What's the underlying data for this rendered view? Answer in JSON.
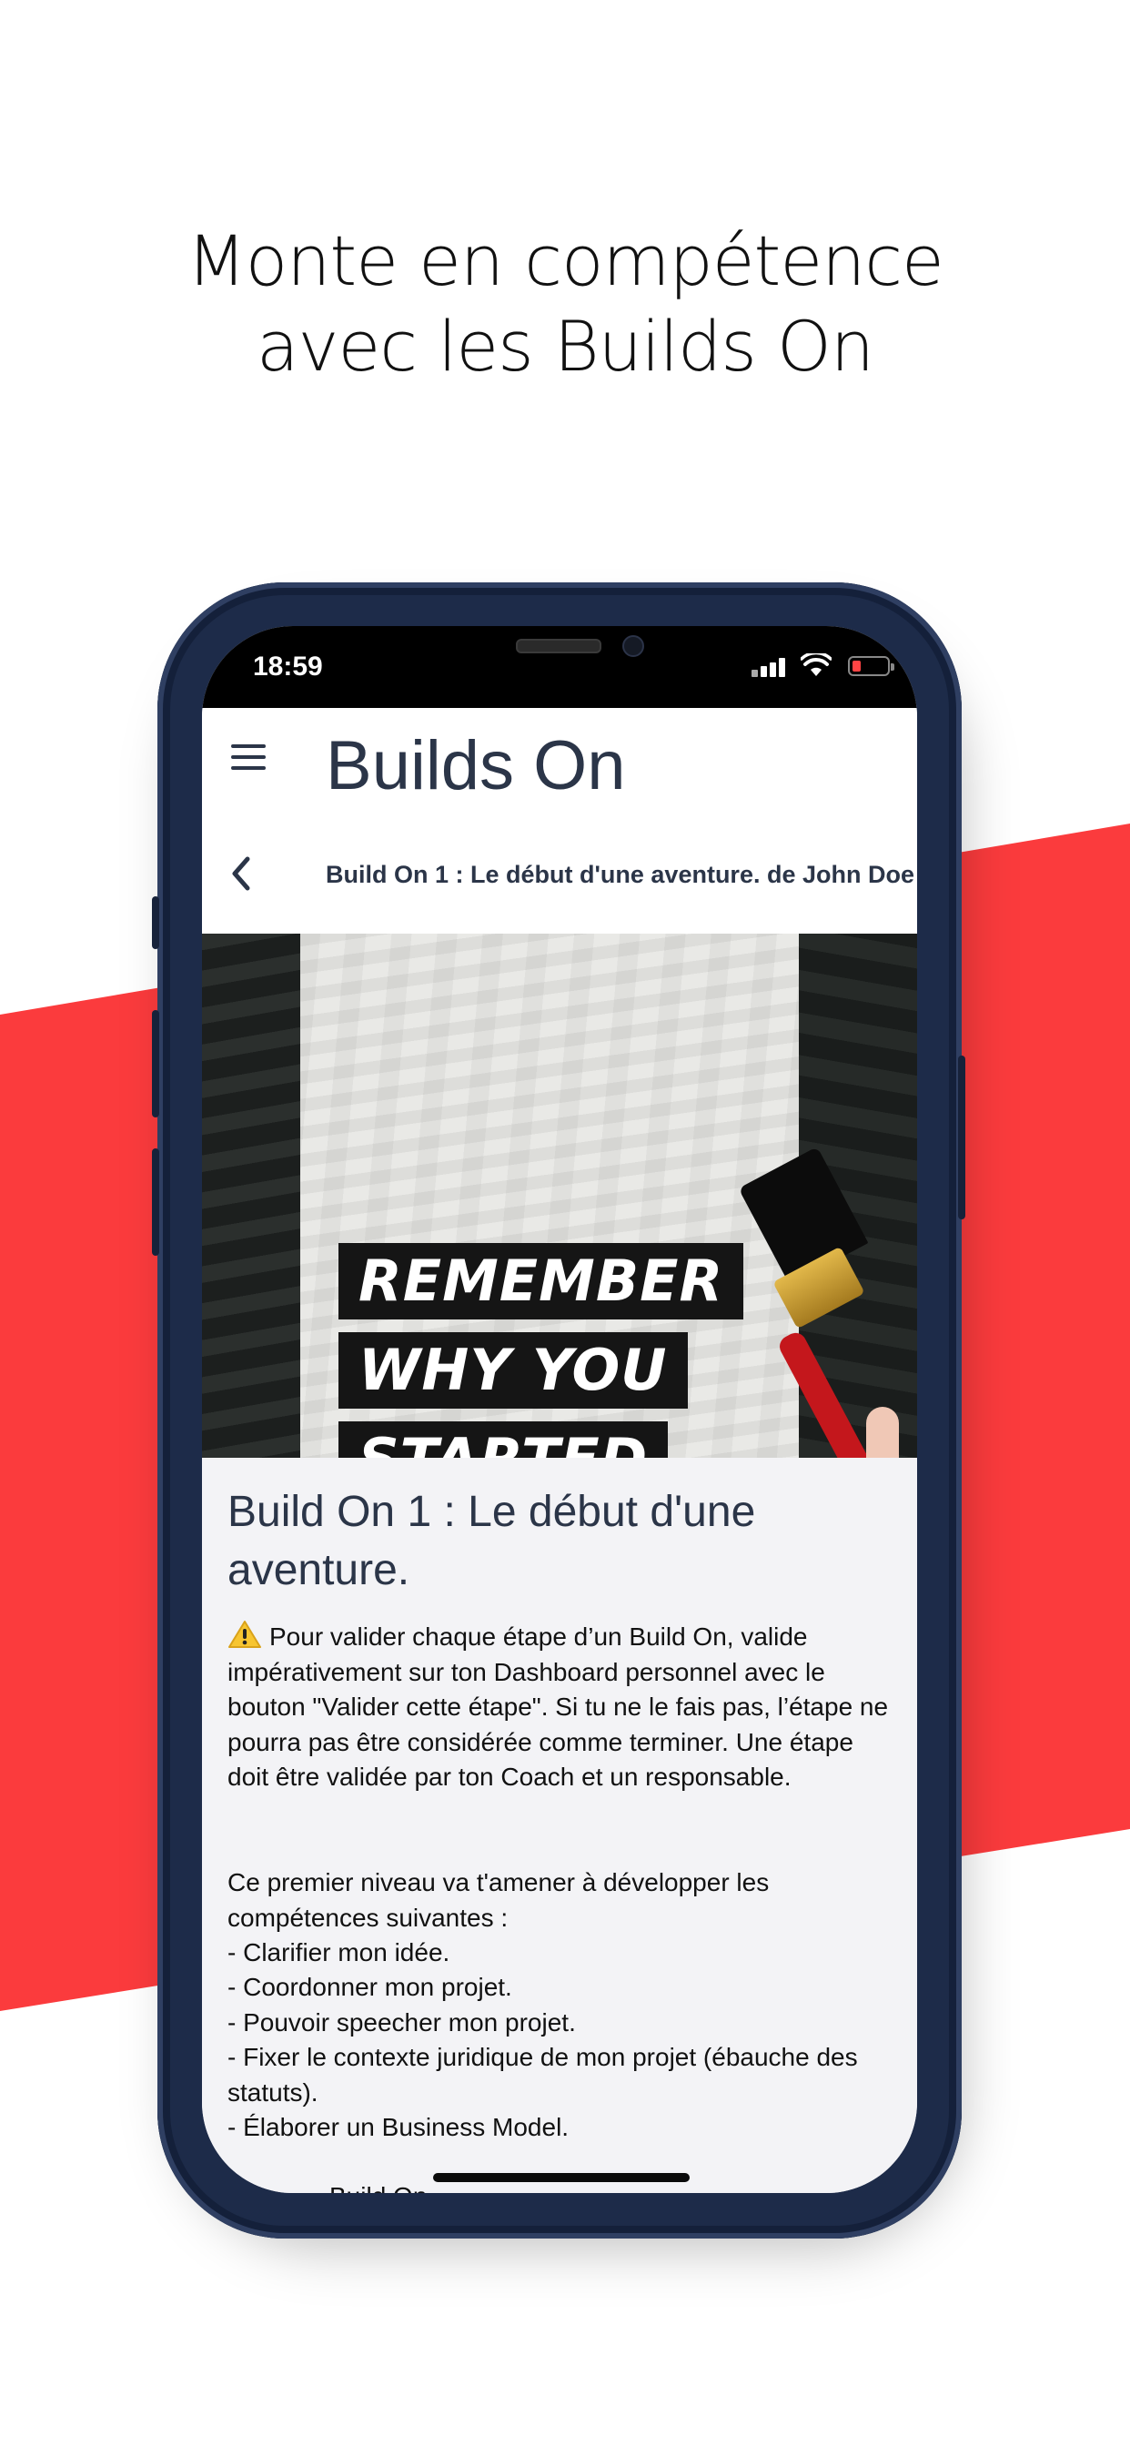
{
  "headline": {
    "line1": "Monte en compétence",
    "line2": "avec les Builds On"
  },
  "status_bar": {
    "time": "18:59",
    "icons": [
      "signal-icon",
      "wifi-icon",
      "battery-low-icon"
    ]
  },
  "app_bar": {
    "menu_icon": "hamburger-menu-icon",
    "title": "Builds On"
  },
  "sub_bar": {
    "back_icon": "chevron-left-icon",
    "title": "Build On 1 : Le début d'une aventure. de John Doe"
  },
  "hero_image": {
    "slogan": [
      "REMEMBER",
      "WHY YOU",
      "STARTED"
    ]
  },
  "content": {
    "title": "Build On 1 : Le début d'une aventure.",
    "warning_icon": "warning-icon",
    "warning_text": "Pour valider chaque étape d’un Build On, valide impérativement sur ton Dashboard personnel avec le bouton \"Valider cette étape\". Si tu ne le fais pas, l’étape ne pourra pas être considérée comme terminer. Une étape doit être validée par ton Coach et un responsable.",
    "skills_intro": "Ce premier niveau va t'amener à développer les compétences suivantes :",
    "skills": [
      "- Clarifier mon idée.",
      "- Coordonner mon projet.",
      "- Pouvoir speecher mon projet.",
      "- Fixer le contexte juridique de mon projet (ébauche des statuts).",
      "- Élaborer un Business Model."
    ],
    "cutoff_text": "Build On ... "
  },
  "colors": {
    "accent_red": "#fb3b3d",
    "phone_frame": "#1d2b49",
    "title_text": "#2b3548"
  }
}
